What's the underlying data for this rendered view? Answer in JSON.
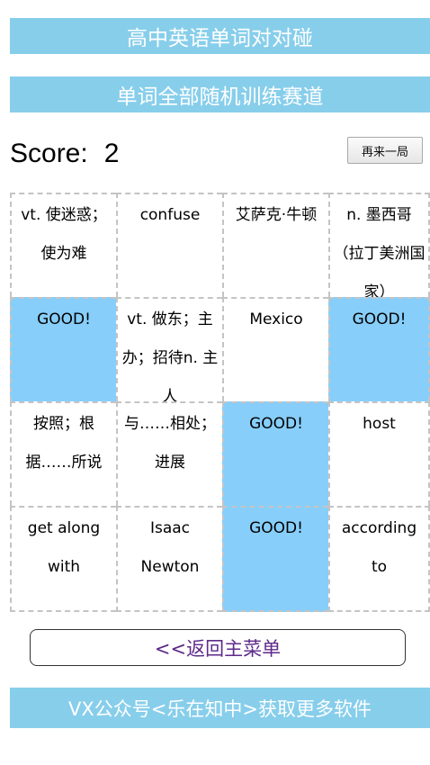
{
  "header": {
    "title": "高中英语单词对对碰",
    "mode": "单词全部随机训练赛道"
  },
  "score": {
    "label": "Score:",
    "value": "2"
  },
  "restart_label": "再来一局",
  "grid": {
    "cells": [
      {
        "text": "vt. 使迷惑；使为难",
        "matched": false
      },
      {
        "text": "confuse",
        "matched": false
      },
      {
        "text": "艾萨克·牛顿",
        "matched": false
      },
      {
        "text": "n. 墨西哥（拉丁美洲国家）",
        "matched": false
      },
      {
        "text": "GOOD!",
        "matched": true
      },
      {
        "text": "vt. 做东；主办；招待n. 主人",
        "matched": false
      },
      {
        "text": "Mexico",
        "matched": false
      },
      {
        "text": "GOOD!",
        "matched": true
      },
      {
        "text": "按照；根据……所说",
        "matched": false
      },
      {
        "text": "与……相处；进展",
        "matched": false
      },
      {
        "text": "GOOD!",
        "matched": true
      },
      {
        "text": "host",
        "matched": false
      },
      {
        "text": "get along with",
        "matched": false
      },
      {
        "text": "Isaac Newton",
        "matched": false
      },
      {
        "text": "GOOD!",
        "matched": true
      },
      {
        "text": "according to",
        "matched": false
      }
    ]
  },
  "back_label": "<<返回主菜单",
  "footer": "VX公众号<乐在知中>获取更多软件",
  "colors": {
    "banner": "#87ceeb",
    "matched_cell": "#87cefa",
    "back_text": "#5e2a8a"
  }
}
